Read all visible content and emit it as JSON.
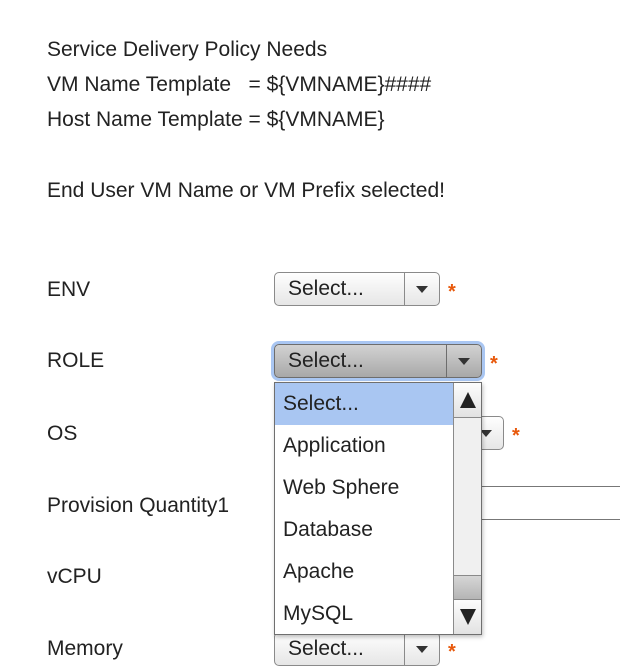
{
  "header": {
    "line1": "Service Delivery Policy Needs",
    "line2": "VM Name Template   = ${VMNAME}####",
    "line3": "Host Name Template = ${VMNAME}",
    "notice": "End User VM Name or VM Prefix selected!"
  },
  "form": {
    "env": {
      "label": "ENV",
      "value": "Select..."
    },
    "role": {
      "label": "ROLE",
      "value": "Select..."
    },
    "os": {
      "label": "OS"
    },
    "provision_quantity": {
      "label": "Provision Quantity1"
    },
    "vcpu": {
      "label": "vCPU"
    },
    "memory": {
      "label": "Memory",
      "value": "Select..."
    },
    "required_marker": "*"
  },
  "role_dropdown": {
    "options": [
      "Select...",
      "Application",
      "Web Sphere",
      "Database",
      "Apache",
      "MySQL"
    ],
    "selected_index": 0
  },
  "colors": {
    "required": "#e8590c",
    "selected_option": "#a9c6f2",
    "focus_ring": "#a9c6f2"
  },
  "icons": {
    "dropdown_arrow": "chevron-down-icon",
    "scroll_up": "scroll-up-icon",
    "scroll_down": "scroll-down-icon",
    "required": "asterisk-icon"
  }
}
